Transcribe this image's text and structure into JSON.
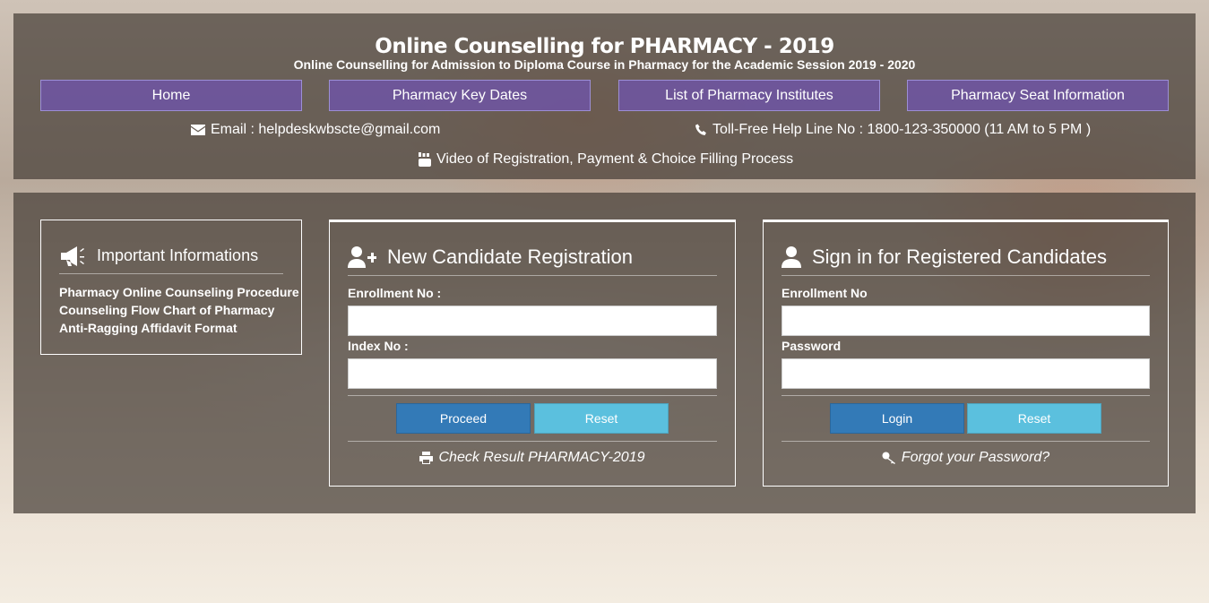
{
  "header": {
    "title": "Online Counselling for PHARMACY - 2019",
    "subtitle": "Online Counselling for Admission to Diploma Course in Pharmacy for the Academic Session 2019 - 2020",
    "nav": [
      {
        "label": "Home"
      },
      {
        "label": "Pharmacy Key Dates"
      },
      {
        "label": "List of Pharmacy Institutes"
      },
      {
        "label": "Pharmacy Seat Information"
      }
    ],
    "email_text": "Email : helpdeskwbscte@gmail.com",
    "helpline_text": "Toll-Free Help Line No : 1800-123-350000 (11 AM to 5 PM )",
    "video_text": "Video of Registration, Payment & Choice Filling Process"
  },
  "info": {
    "title": "Important Informations",
    "links": [
      "Pharmacy Online Counseling Procedure",
      "Counseling Flow Chart of Pharmacy",
      "Anti-Ragging Affidavit Format"
    ]
  },
  "register": {
    "title": "New Candidate Registration",
    "enrollment_label": "Enrollment No :",
    "enrollment_value": "",
    "index_label": "Index No :",
    "index_value": "",
    "proceed_label": "Proceed",
    "reset_label": "Reset",
    "result_link": "Check Result PHARMACY-2019"
  },
  "signin": {
    "title": "Sign in for Registered Candidates",
    "enrollment_label": "Enrollment No",
    "enrollment_value": "",
    "password_label": "Password",
    "password_value": "",
    "login_label": "Login",
    "reset_label": "Reset",
    "forgot_link": "Forgot your Password?"
  },
  "colors": {
    "nav_button": "#6e55a5",
    "primary_button": "#337ab7",
    "info_button": "#5bc0de",
    "panel_overlay": "#463e38"
  }
}
